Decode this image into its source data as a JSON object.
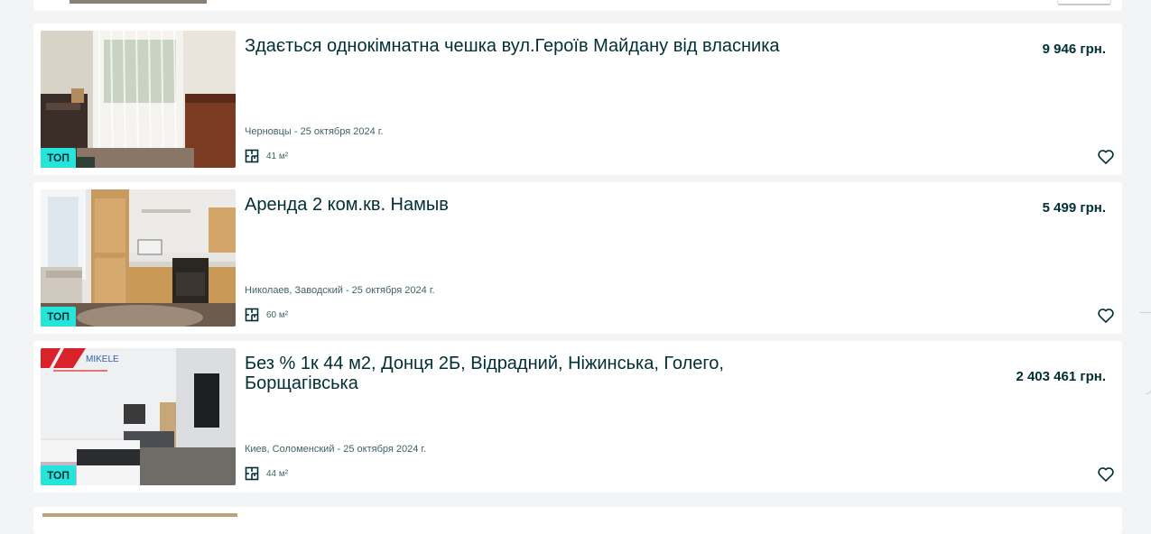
{
  "listings": [
    {
      "title": "Здається однокімнатна чешка вул.Героїв Майдану від власника",
      "price": "9 946 грн.",
      "location_date": "Черновцы - 25 октября 2024 г.",
      "area": "41 м²",
      "badge": "ТОП"
    },
    {
      "title": "Аренда 2 ком.кв. Намыв",
      "price": "5 499 грн.",
      "location_date": "Николаев, Заводский - 25 октября 2024 г.",
      "area": "60 м²",
      "badge": "ТОП"
    },
    {
      "title": "Без % 1к 44 м2, Донця 2Б, Відрадний, Ніжинська, Голего, Борщагівська",
      "price": "2 403 461 грн.",
      "location_date": "Киев, Соломенский - 25 октября 2024 г.",
      "area": "44 м²",
      "badge": "ТОП",
      "photo_logo": "MIKELE"
    }
  ],
  "icons": {
    "area": "floor-plan-icon",
    "favorite": "heart-outline-icon"
  },
  "colors": {
    "badge": "#23e5db",
    "text": "#002f34",
    "muted": "#406367",
    "background": "#f2f4f5",
    "logo_red": "#d8232a"
  }
}
